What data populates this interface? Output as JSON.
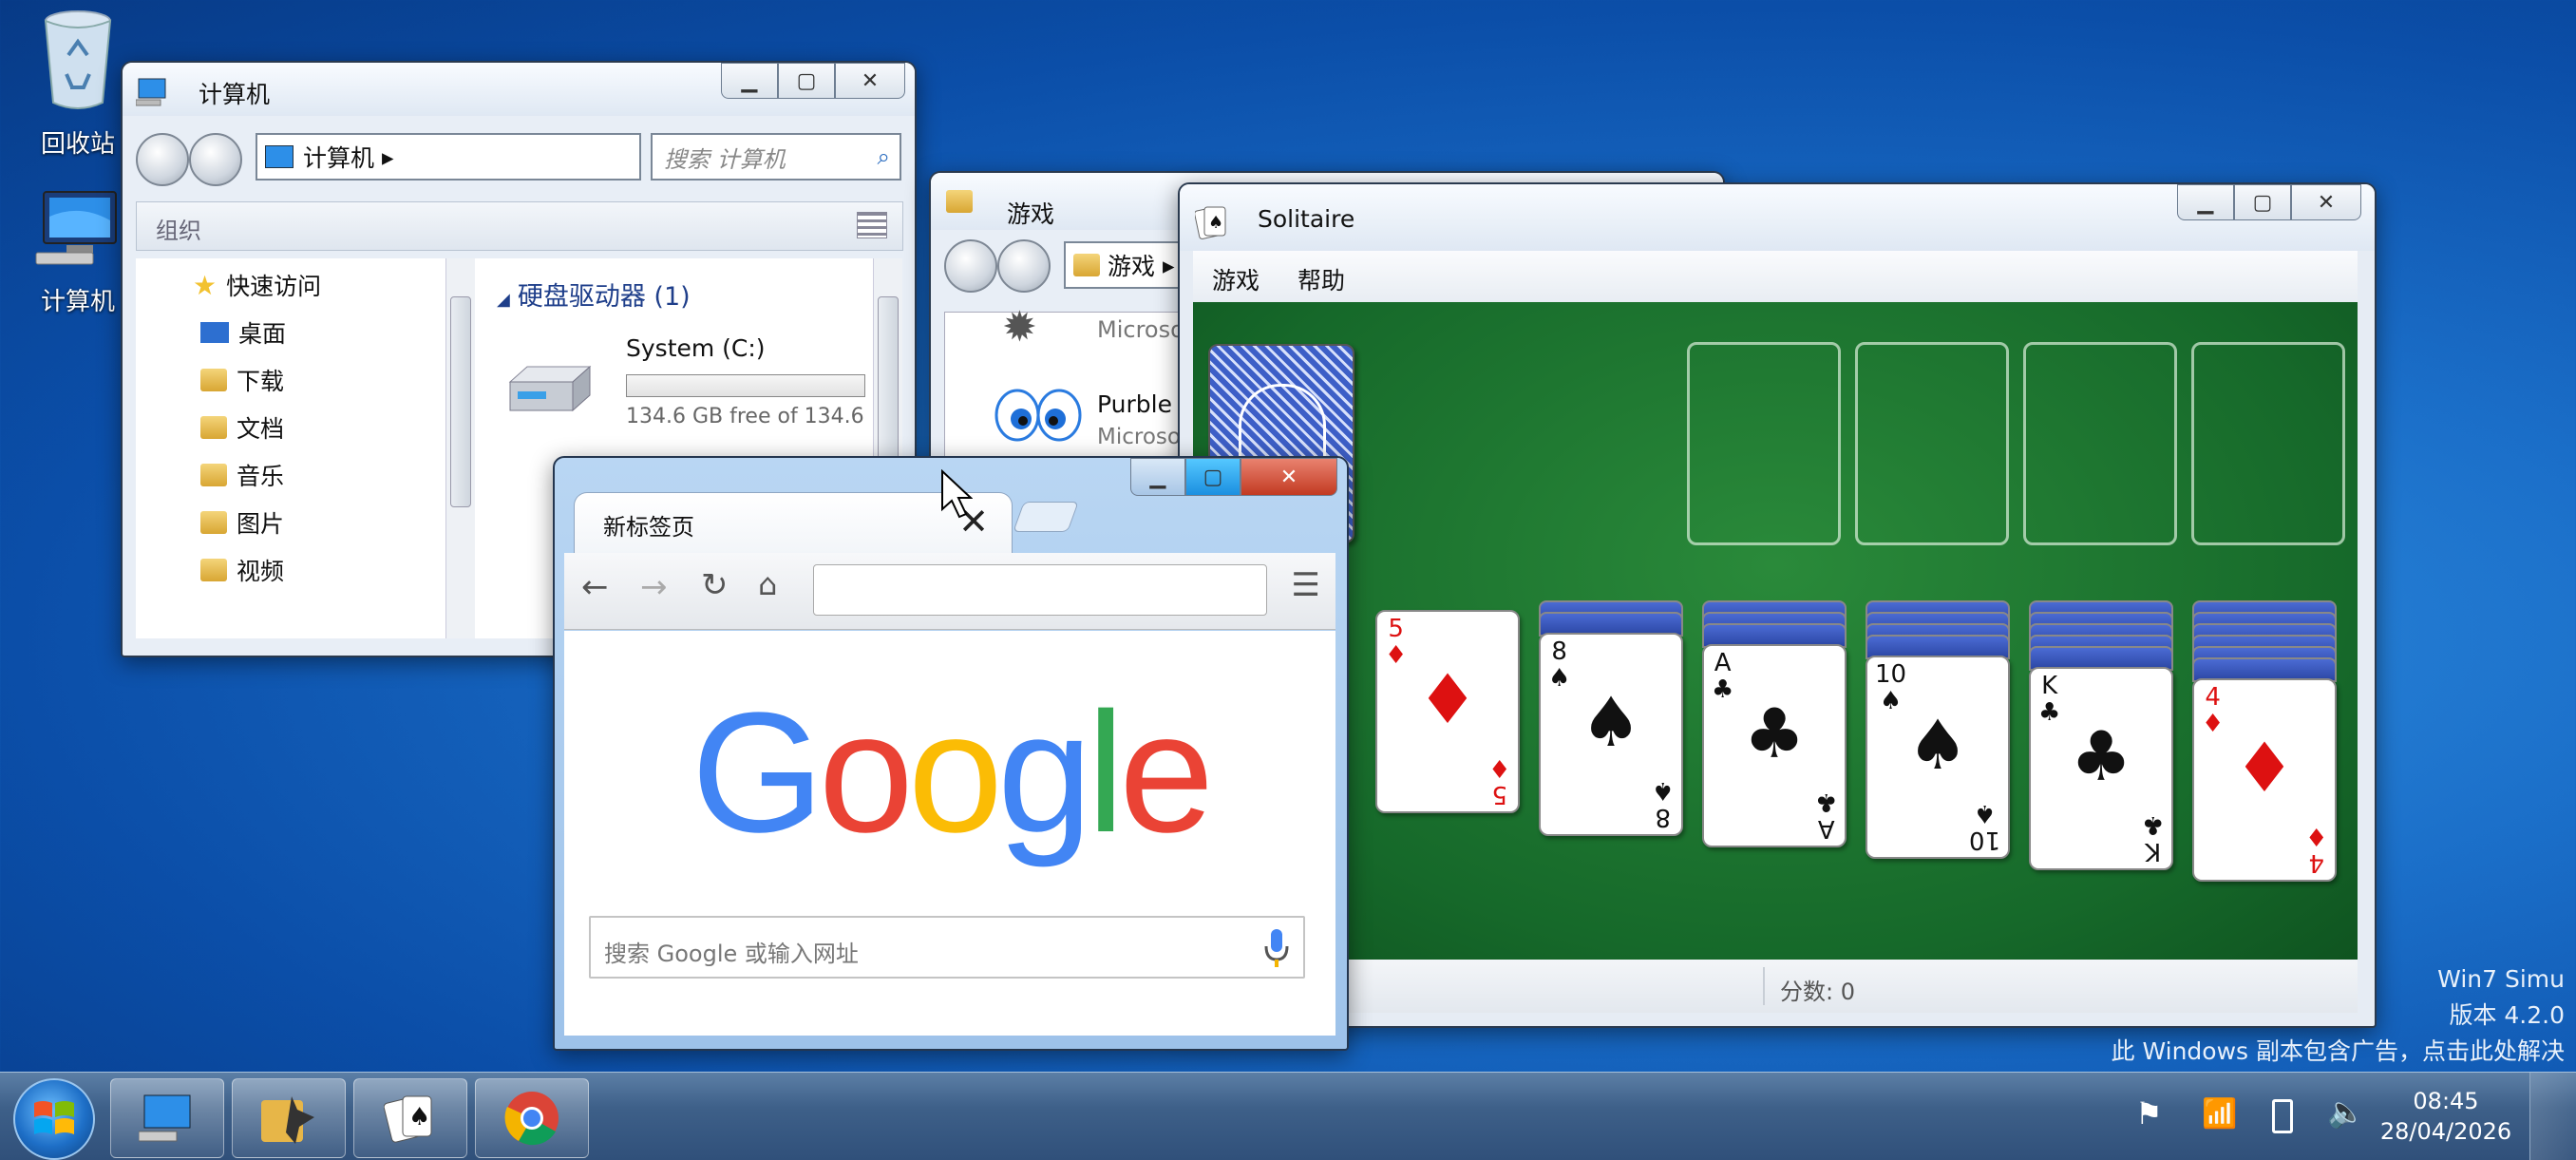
{
  "desktop": {
    "icons": [
      {
        "label": "回收站",
        "icon": "recycle-bin-icon"
      },
      {
        "label": "计算机",
        "icon": "computer-icon"
      }
    ],
    "watermark": {
      "line1": "Win7 Simu",
      "line2": "版本 4.2.0",
      "line3": "此 Windows 副本包含广告，点击此处解决"
    }
  },
  "explorer": {
    "title": "计算机",
    "address": "计算机",
    "search_placeholder": "搜索 计算机",
    "organize": "组织",
    "nav": [
      "快速访问",
      "桌面",
      "下载",
      "文档",
      "音乐",
      "图片",
      "视频"
    ],
    "group_header": "硬盘驱动器 (1)",
    "drive_name": "System (C:)",
    "drive_free": "134.6 GB free of 134.6",
    "drive_used_fraction": 0.0
  },
  "games": {
    "title": "游戏",
    "address": "游戏",
    "items": [
      {
        "name": "Microsoft",
        "sub": ""
      },
      {
        "name": "Purble",
        "sub": "Microso"
      }
    ]
  },
  "solitaire": {
    "title": "Solitaire",
    "menu": [
      "游戏",
      "帮助"
    ],
    "score": "分数: 0",
    "tableau": [
      {
        "rank": "5",
        "suit": "♦",
        "color": "red",
        "down": 0
      },
      {
        "rank": "8",
        "suit": "♠",
        "color": "black",
        "down": 2
      },
      {
        "rank": "A",
        "suit": "♣",
        "color": "black",
        "down": 3
      },
      {
        "rank": "10",
        "suit": "♠",
        "color": "black",
        "down": 4
      },
      {
        "rank": "K",
        "suit": "♣",
        "color": "black",
        "down": 5
      },
      {
        "rank": "4",
        "suit": "♦",
        "color": "red",
        "down": 6
      }
    ]
  },
  "browser": {
    "tab_title": "新标签页",
    "logo_letters": [
      {
        "ch": "G",
        "color": "#4285f4"
      },
      {
        "ch": "o",
        "color": "#ea4335"
      },
      {
        "ch": "o",
        "color": "#fbbc05"
      },
      {
        "ch": "g",
        "color": "#4285f4"
      },
      {
        "ch": "l",
        "color": "#34a853"
      },
      {
        "ch": "e",
        "color": "#ea4335"
      }
    ],
    "search_placeholder": "搜索 Google 或输入网址"
  },
  "taskbar": {
    "time": "08:45",
    "date": "28/04/2026",
    "buttons": [
      "computer-icon",
      "games-folder-icon",
      "solitaire-icon",
      "chrome-icon"
    ]
  }
}
